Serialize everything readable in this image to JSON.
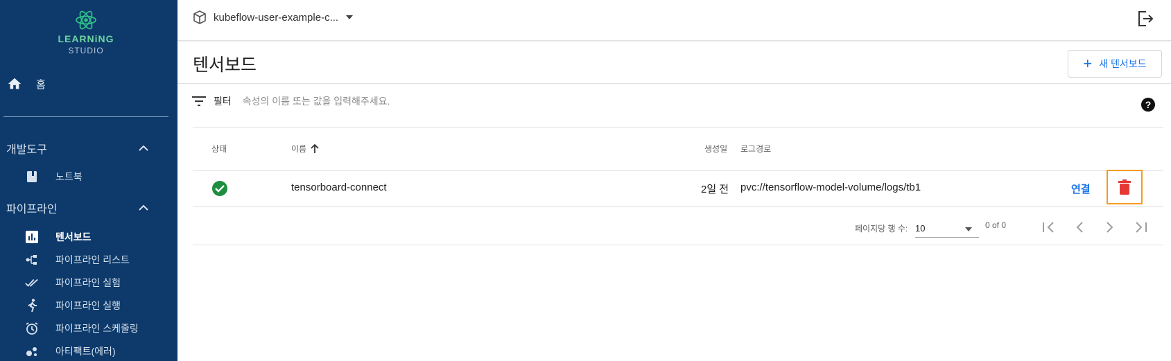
{
  "sidebar": {
    "logo": {
      "line1": "LEARNiNG",
      "line2": "STUDIO"
    },
    "home": {
      "label": "홈",
      "icon": "home-icon"
    },
    "sections": [
      {
        "label": "개발도구",
        "items": [
          {
            "label": "노트북",
            "icon": "book-icon"
          }
        ]
      },
      {
        "label": "파이프라인",
        "items": [
          {
            "label": "텐서보드",
            "icon": "bar-chart-icon",
            "active": true
          },
          {
            "label": "파이프라인 리스트",
            "icon": "pipeline-icon"
          },
          {
            "label": "파이프라인 실험",
            "icon": "done-all-icon"
          },
          {
            "label": "파이프라인 실행",
            "icon": "run-icon"
          },
          {
            "label": "파이프라인 스케줄링",
            "icon": "alarm-icon"
          },
          {
            "label": "아티팩트(에러)",
            "icon": "bubble-chart-icon"
          }
        ]
      }
    ]
  },
  "topbar": {
    "namespace": "kubeflow-user-example-c...",
    "namespace_icon": "package-icon",
    "logout_icon": "logout-icon"
  },
  "page": {
    "title": "텐서보드",
    "new_button": "새 텐서보드"
  },
  "filter": {
    "label": "필터",
    "placeholder": "속성의 이름 또는 값을 입력해주세요."
  },
  "table": {
    "headers": {
      "status": "상태",
      "name": "이름",
      "created": "생성일",
      "logpath": "로그경로"
    },
    "sort": {
      "column": "name",
      "direction": "asc"
    },
    "rows": [
      {
        "status": "ready",
        "name": "tensorboard-connect",
        "created": "2일 전",
        "logpath": "pvc://tensorflow-model-volume/logs/tb1",
        "action": "연결"
      }
    ]
  },
  "paginator": {
    "rows_label": "페이지당 행 수:",
    "page_size": "10",
    "range": "0 of 0"
  },
  "colors": {
    "sidebar_bg": "#0d3a6b",
    "accent": "#1a73e8",
    "success": "#1e8e3e",
    "danger": "#e53935",
    "highlight": "#f59a23"
  }
}
